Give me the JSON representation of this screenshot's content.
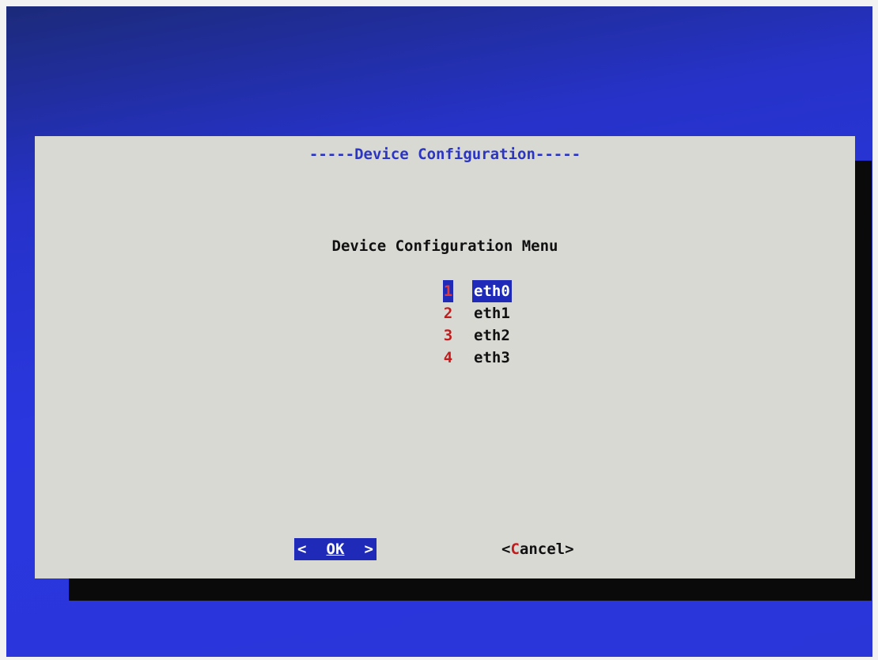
{
  "dialog": {
    "title": "-----Device Configuration-----",
    "heading": "Device Configuration Menu"
  },
  "menu": {
    "items": [
      {
        "key": "1",
        "label": "eth0",
        "selected": true
      },
      {
        "key": "2",
        "label": "eth1",
        "selected": false
      },
      {
        "key": "3",
        "label": "eth2",
        "selected": false
      },
      {
        "key": "4",
        "label": "eth3",
        "selected": false
      }
    ]
  },
  "buttons": {
    "ok": {
      "left": "<",
      "label": "OK",
      "right": ">"
    },
    "cancel": {
      "open": "<",
      "hotkey": "C",
      "rest": "ancel",
      "close": ">"
    }
  },
  "colors": {
    "background": "#2a37e0",
    "dialog": "#d9d9d4",
    "title_text": "#2b35c4",
    "highlight": "#1f2bb8",
    "hotkey": "#c41c1c"
  }
}
